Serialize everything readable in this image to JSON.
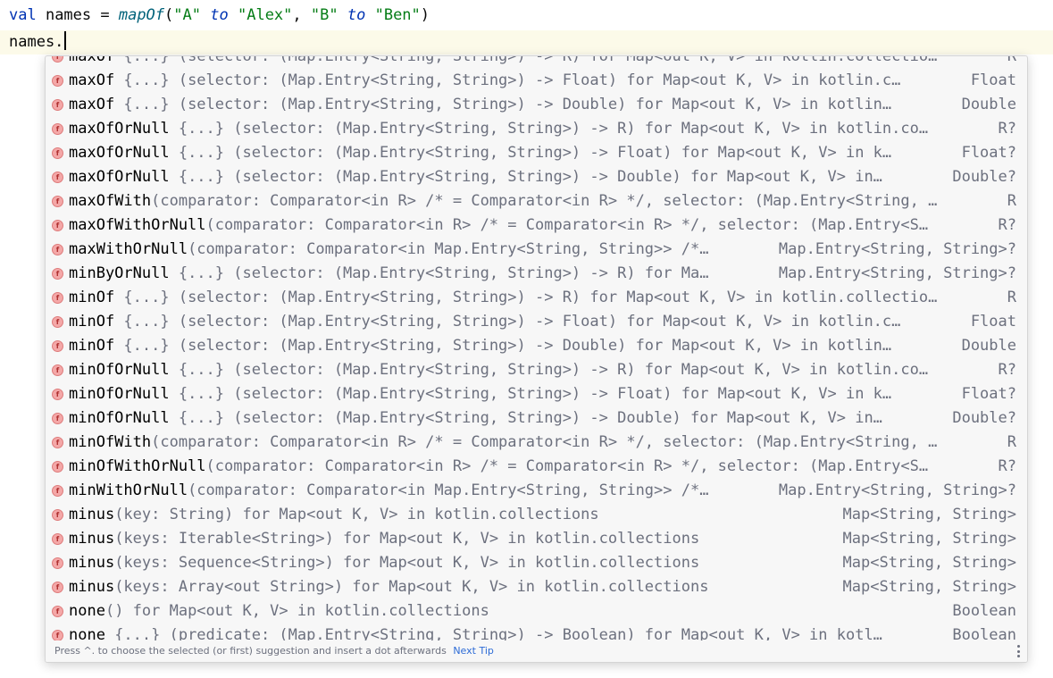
{
  "editor": {
    "line1": {
      "kw_val": "val",
      "text_a": " names = ",
      "fn_mapof": "mapOf",
      "paren_open": "(",
      "s1": "\"A\"",
      "to1": "to",
      "s2": "\"Alex\"",
      "comma": ", ",
      "s3": "\"B\"",
      "to2": "to",
      "s4": "\"Ben\"",
      "paren_close": ")"
    },
    "line2": {
      "text": "names."
    }
  },
  "completion": {
    "badge_glyph": "f",
    "items": [
      {
        "name": "maxOf",
        "tail": " {...} (selector: (Map.Entry<String, String>) -> R) for Map<out K, V> in kotlin.collectio…",
        "type": "R"
      },
      {
        "name": "maxOf",
        "tail": " {...} (selector: (Map.Entry<String, String>) -> Float) for Map<out K, V> in kotlin.c…",
        "type": "Float"
      },
      {
        "name": "maxOf",
        "tail": " {...} (selector: (Map.Entry<String, String>) -> Double) for Map<out K, V> in kotlin…",
        "type": "Double"
      },
      {
        "name": "maxOfOrNull",
        "tail": " {...} (selector: (Map.Entry<String, String>) -> R) for Map<out K, V> in kotlin.co…",
        "type": "R?"
      },
      {
        "name": "maxOfOrNull",
        "tail": " {...} (selector: (Map.Entry<String, String>) -> Float) for Map<out K, V> in k…",
        "type": "Float?"
      },
      {
        "name": "maxOfOrNull",
        "tail": " {...} (selector: (Map.Entry<String, String>) -> Double) for Map<out K, V> in…",
        "type": "Double?"
      },
      {
        "name": "maxOfWith",
        "tail": "(comparator: Comparator<in R> /* = Comparator<in R> */, selector: (Map.Entry<String, …",
        "type": "R"
      },
      {
        "name": "maxOfWithOrNull",
        "tail": "(comparator: Comparator<in R> /* = Comparator<in R> */, selector: (Map.Entry<S…",
        "type": "R?"
      },
      {
        "name": "maxWithOrNull",
        "tail": "(comparator: Comparator<in Map.Entry<String, String>> /*…",
        "type": "Map.Entry<String, String>?"
      },
      {
        "name": "minByOrNull",
        "tail": " {...} (selector: (Map.Entry<String, String>) -> R) for Ma…",
        "type": "Map.Entry<String, String>?"
      },
      {
        "name": "minOf",
        "tail": " {...} (selector: (Map.Entry<String, String>) -> R) for Map<out K, V> in kotlin.collectio…",
        "type": "R"
      },
      {
        "name": "minOf",
        "tail": " {...} (selector: (Map.Entry<String, String>) -> Float) for Map<out K, V> in kotlin.c…",
        "type": "Float"
      },
      {
        "name": "minOf",
        "tail": " {...} (selector: (Map.Entry<String, String>) -> Double) for Map<out K, V> in kotlin…",
        "type": "Double"
      },
      {
        "name": "minOfOrNull",
        "tail": " {...} (selector: (Map.Entry<String, String>) -> R) for Map<out K, V> in kotlin.co…",
        "type": "R?"
      },
      {
        "name": "minOfOrNull",
        "tail": " {...} (selector: (Map.Entry<String, String>) -> Float) for Map<out K, V> in k…",
        "type": "Float?"
      },
      {
        "name": "minOfOrNull",
        "tail": " {...} (selector: (Map.Entry<String, String>) -> Double) for Map<out K, V> in…",
        "type": "Double?"
      },
      {
        "name": "minOfWith",
        "tail": "(comparator: Comparator<in R> /* = Comparator<in R> */, selector: (Map.Entry<String, …",
        "type": "R"
      },
      {
        "name": "minOfWithOrNull",
        "tail": "(comparator: Comparator<in R> /* = Comparator<in R> */, selector: (Map.Entry<S…",
        "type": "R?"
      },
      {
        "name": "minWithOrNull",
        "tail": "(comparator: Comparator<in Map.Entry<String, String>> /*…",
        "type": "Map.Entry<String, String>?"
      },
      {
        "name": "minus",
        "tail": "(key: String) for Map<out K, V> in kotlin.collections",
        "type": "Map<String, String>"
      },
      {
        "name": "minus",
        "tail": "(keys: Iterable<String>) for Map<out K, V> in kotlin.collections",
        "type": "Map<String, String>"
      },
      {
        "name": "minus",
        "tail": "(keys: Sequence<String>) for Map<out K, V> in kotlin.collections",
        "type": "Map<String, String>"
      },
      {
        "name": "minus",
        "tail": "(keys: Array<out String>) for Map<out K, V> in kotlin.collections",
        "type": "Map<String, String>"
      },
      {
        "name": "none",
        "tail": "() for Map<out K, V> in kotlin.collections",
        "type": "Boolean"
      },
      {
        "name": "none",
        "tail": " {...} (predicate: (Map.Entry<String, String>) -> Boolean) for Map<out K, V> in kotl…",
        "type": "Boolean"
      }
    ],
    "footer": {
      "hint": "Press ^. to choose the selected (or first) suggestion and insert a dot afterwards",
      "next_tip": "Next Tip"
    }
  }
}
